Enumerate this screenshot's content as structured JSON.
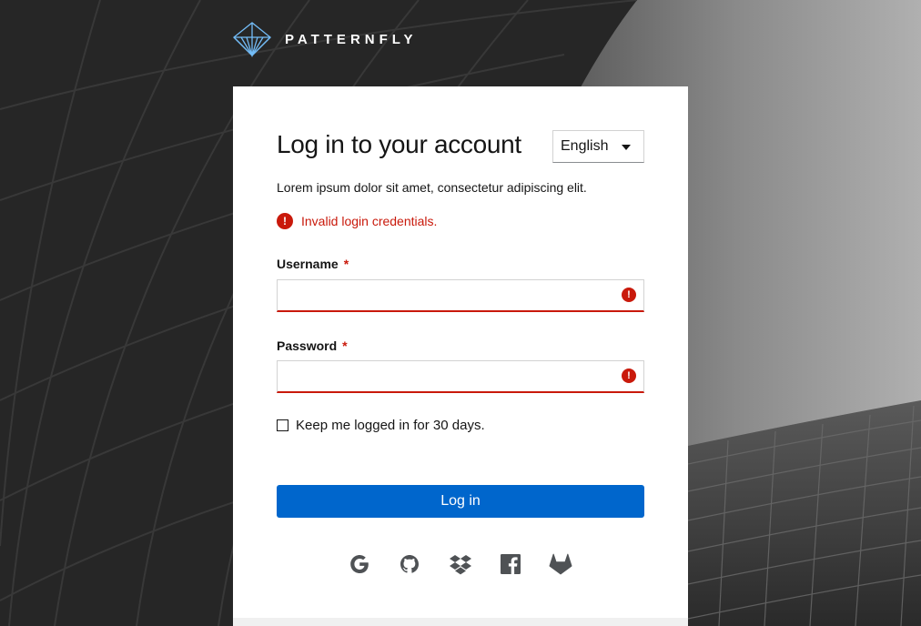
{
  "brand": {
    "name": "PATTERNFLY"
  },
  "login": {
    "title": "Log in to your account",
    "subtitle": "Lorem ipsum dolor sit amet, consectetur adipiscing elit.",
    "language": {
      "selected": "English"
    },
    "error_message": "Invalid login credentials.",
    "username": {
      "label": "Username",
      "required_mark": "*",
      "value": ""
    },
    "password": {
      "label": "Password",
      "required_mark": "*",
      "value": ""
    },
    "remember_label": "Keep me logged in for 30 days.",
    "submit_label": "Log in",
    "social_providers": [
      "google-icon",
      "github-icon",
      "dropbox-icon",
      "facebook-icon",
      "gitlab-icon"
    ]
  },
  "colors": {
    "primary": "#0066cc",
    "danger": "#c9190b",
    "text": "#151515",
    "icon": "#4f5255",
    "card_bg": "#ffffff"
  }
}
